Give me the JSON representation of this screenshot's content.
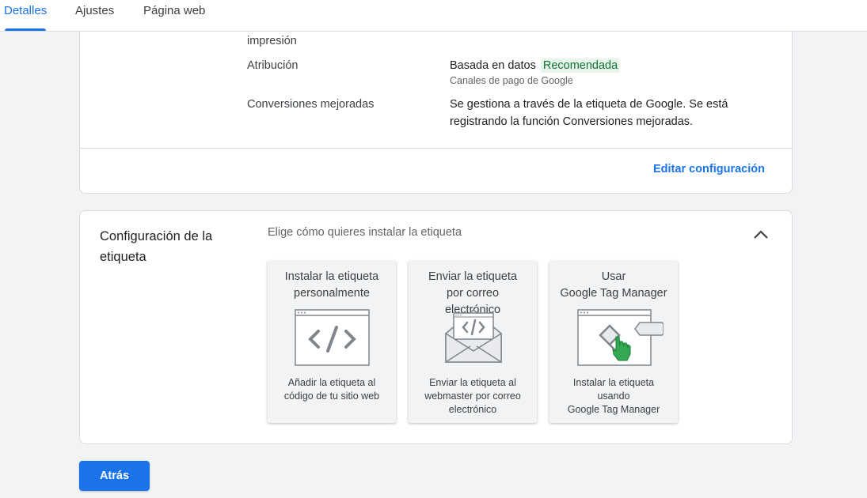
{
  "tabs": [
    {
      "label": "Detalles"
    },
    {
      "label": "Ajustes"
    },
    {
      "label": "Página web"
    }
  ],
  "details": {
    "truncated_label": "impresión",
    "attribution": {
      "label": "Atribución",
      "value": "Basada en datos",
      "badge": "Recomendada",
      "sub": "Canales de pago de Google"
    },
    "enhanced": {
      "label": "Conversiones mejoradas",
      "value_line1": "Se gestiona a través de la etiqueta de Google. Se está",
      "value_line2": "registrando la función Conversiones mejoradas."
    },
    "edit_link": "Editar configuración"
  },
  "tag_setup": {
    "title": "Configuración de la etiqueta",
    "subtitle": "Elige cómo quieres instalar la etiqueta",
    "options": [
      {
        "title_line1": "Instalar la etiqueta",
        "title_line2": "personalmente",
        "desc_line1": "Añadir la etiqueta al",
        "desc_line2": "código de tu sitio web",
        "icon": "code-window-icon"
      },
      {
        "title_line1": "Enviar la etiqueta",
        "title_line2": "por correo",
        "title_line3": "electrónico",
        "desc_line1": "Enviar la etiqueta al",
        "desc_line2": "webmaster por correo",
        "desc_line3": "electrónico",
        "icon": "email-envelope-icon"
      },
      {
        "title_line1": "Usar",
        "title_line2": "Google Tag Manager",
        "desc_line1": "Instalar la etiqueta",
        "desc_line2": "usando",
        "desc_line3": "Google Tag Manager",
        "icon": "tag-manager-icon"
      }
    ]
  },
  "footer": {
    "back_label": "Atrás"
  },
  "colors": {
    "accent": "#1a73e8",
    "badge_bg": "#e6f4ea",
    "badge_text": "#137333",
    "pointer_green": "#34a853"
  }
}
